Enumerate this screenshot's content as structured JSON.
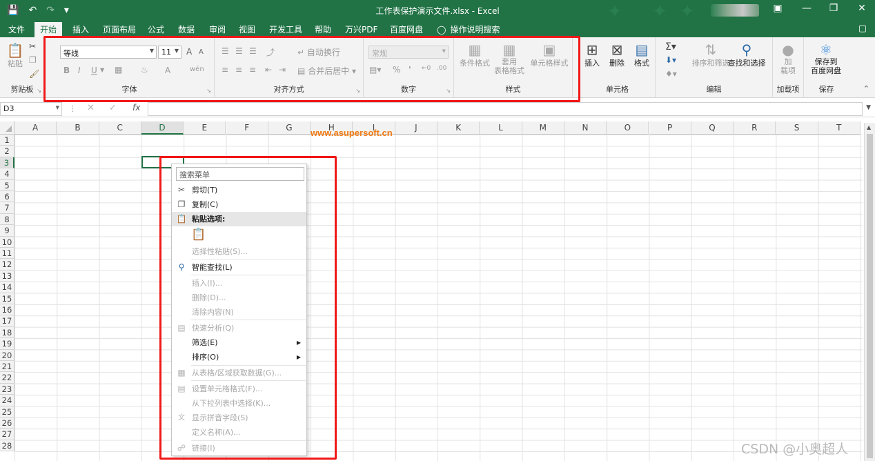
{
  "titlebar": {
    "title": "工作表保护演示文件.xlsx  -  Excel",
    "save_icon": "save-icon",
    "undo_icon": "undo-icon",
    "redo_icon": "redo-icon",
    "customize_icon": "customize-qat-icon"
  },
  "tabs": [
    "文件",
    "开始",
    "插入",
    "页面布局",
    "公式",
    "数据",
    "审阅",
    "视图",
    "开发工具",
    "帮助",
    "万兴PDF",
    "百度网盘"
  ],
  "active_tab": "开始",
  "tell_me": "操作说明搜索",
  "ribbon": {
    "clipboard": {
      "paste": "粘贴",
      "label": "剪贴板"
    },
    "font": {
      "name": "等线",
      "size": "11",
      "label": "字体",
      "bold": "B",
      "italic": "I",
      "underline": "U",
      "grow": "A",
      "shrink": "A",
      "color_a": "A",
      "phonetic": "wén"
    },
    "alignment": {
      "wrap": "自动换行",
      "merge": "合并后居中",
      "label": "对齐方式"
    },
    "number": {
      "format": "常规",
      "percent": "%",
      "comma": "'",
      "label": "数字"
    },
    "styles": {
      "conditional": "条件格式",
      "table_format_1": "套用",
      "table_format_2": "表格格式",
      "cell_styles": "单元格样式",
      "label": "样式"
    },
    "cells": {
      "insert": "插入",
      "delete": "删除",
      "format": "格式",
      "label": "单元格"
    },
    "editing": {
      "sort_filter": "排序和筛选",
      "find_select": "查找和选择",
      "label": "编辑"
    },
    "addins": {
      "addin_1": "加",
      "addin_2": "载项",
      "label": "加载项"
    },
    "save": {
      "save_1": "保存到",
      "save_2": "百度网盘",
      "label": "保存"
    }
  },
  "formula_bar": {
    "name_box": "D3",
    "fx": "fx",
    "value": ""
  },
  "columns": [
    "A",
    "B",
    "C",
    "D",
    "E",
    "F",
    "G",
    "H",
    "I",
    "J",
    "K",
    "L",
    "M",
    "N",
    "O",
    "P",
    "Q",
    "R",
    "S",
    "T"
  ],
  "rows": [
    "1",
    "2",
    "3",
    "4",
    "5",
    "6",
    "7",
    "8",
    "9",
    "10",
    "11",
    "12",
    "13",
    "14",
    "15",
    "16",
    "17",
    "18",
    "19",
    "20",
    "21",
    "22",
    "23",
    "24",
    "25",
    "26",
    "27",
    "28"
  ],
  "selected_cell": "D3",
  "watermark": "www.asupersoft.cn",
  "context_menu": {
    "search_placeholder": "搜索菜单",
    "cut": "剪切(T)",
    "copy": "复制(C)",
    "paste_options": "粘贴选项:",
    "paste_special": "选择性粘贴(S)...",
    "smart_lookup": "智能查找(L)",
    "insert": "插入(I)...",
    "delete": "删除(D)...",
    "clear": "清除内容(N)",
    "quick_analysis": "快速分析(Q)",
    "filter": "筛选(E)",
    "sort": "排序(O)",
    "get_data": "从表格/区域获取数据(G)...",
    "format_cells": "设置单元格格式(F)...",
    "pick_list": "从下拉列表中选择(K)...",
    "phonetic": "显示拼音字段(S)",
    "define_name": "定义名称(A)...",
    "link": "链接(I)"
  },
  "credit": "CSDN @小奥超人",
  "colors": {
    "excel_green": "#217346",
    "highlight_red": "#f01818",
    "watermark_orange": "#f27b13"
  }
}
